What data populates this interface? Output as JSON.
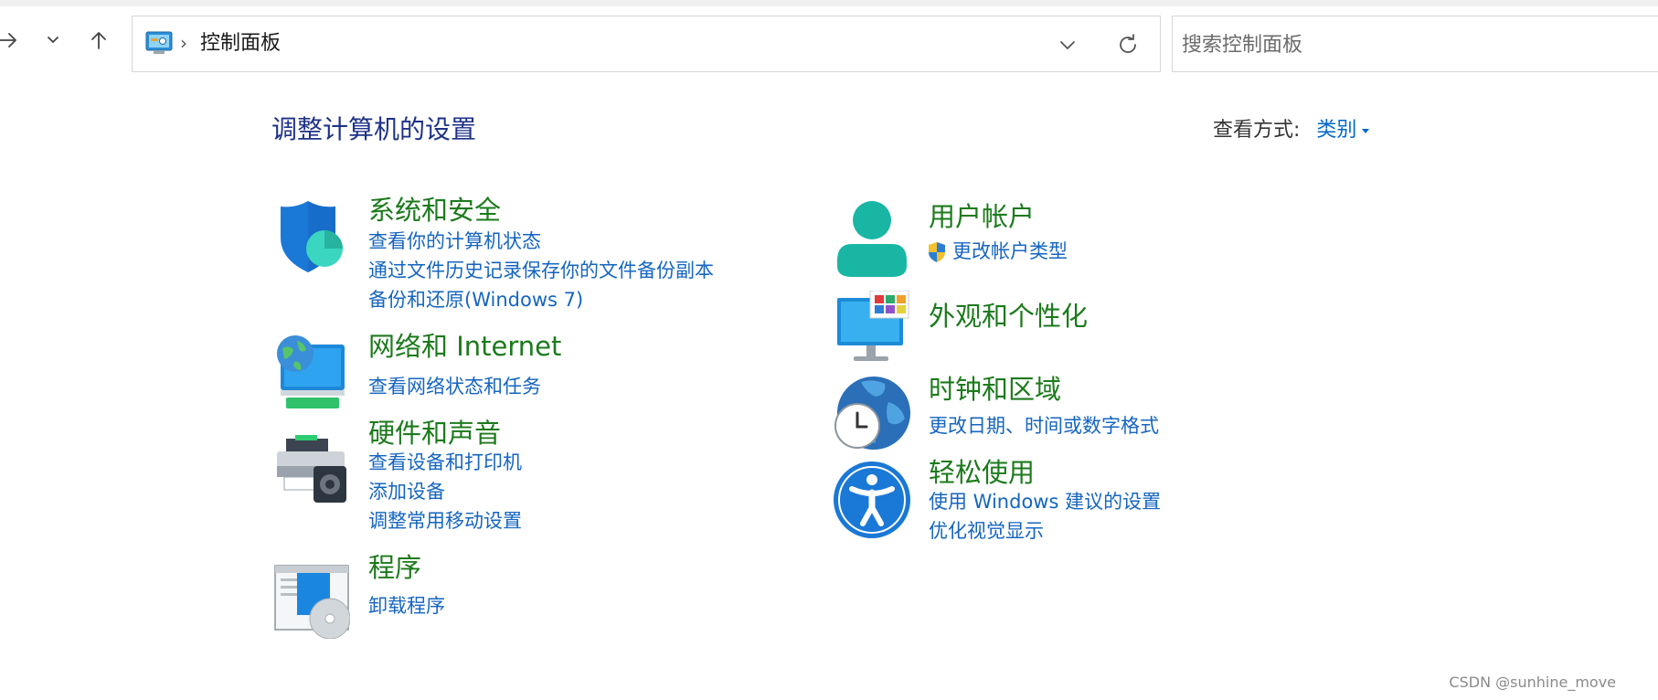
{
  "address_bar": {
    "breadcrumb": "控制面板",
    "separator": "›"
  },
  "search": {
    "placeholder": "搜索控制面板"
  },
  "main": {
    "title": "调整计算机的设置",
    "view_by_label": "查看方式:",
    "view_by_value": "类别"
  },
  "categories": {
    "system_security": {
      "heading": "系统和安全",
      "links": [
        "查看你的计算机状态",
        "通过文件历史记录保存你的文件备份副本",
        "备份和还原(Windows 7)"
      ]
    },
    "network": {
      "heading": "网络和 Internet",
      "links": [
        "查看网络状态和任务"
      ]
    },
    "hardware": {
      "heading": "硬件和声音",
      "links": [
        "查看设备和打印机",
        "添加设备",
        "调整常用移动设置"
      ]
    },
    "programs": {
      "heading": "程序",
      "links": [
        "卸载程序"
      ]
    },
    "user_accounts": {
      "heading": "用户帐户",
      "links": [
        "更改帐户类型"
      ]
    },
    "appearance": {
      "heading": "外观和个性化",
      "links": []
    },
    "clock_region": {
      "heading": "时钟和区域",
      "links": [
        "更改日期、时间或数字格式"
      ]
    },
    "ease_of_access": {
      "heading": "轻松使用",
      "links": [
        "使用 Windows 建议的设置",
        "优化视觉显示"
      ]
    }
  },
  "icons": {
    "forward": "arrow-right-icon",
    "recent": "chevron-down-icon",
    "up": "arrow-up-icon",
    "refresh": "refresh-icon",
    "shield": "uac-shield-icon"
  },
  "colors": {
    "heading_green": "#1c7a1c",
    "link_blue": "#1565c0",
    "title_blue": "#1e3287"
  },
  "watermark": "CSDN @sunhine_move"
}
